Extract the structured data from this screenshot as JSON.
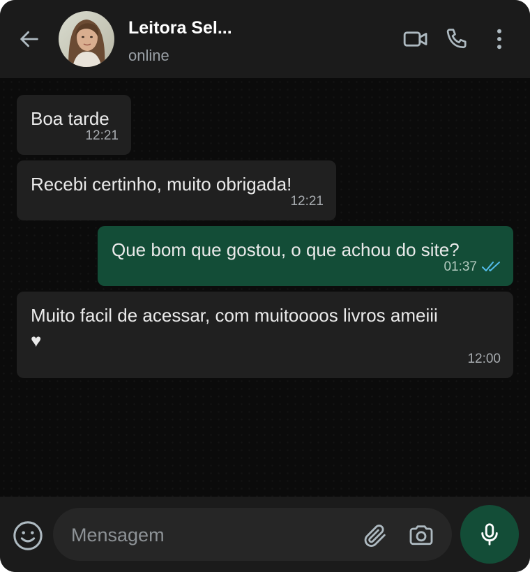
{
  "header": {
    "contact_name": "Leitora Sel...",
    "status": "online",
    "icons": {
      "back": "arrow-left-icon",
      "video": "video-camera-icon",
      "call": "phone-icon",
      "menu": "more-vertical-icon"
    }
  },
  "messages": [
    {
      "direction": "incoming",
      "text": "Boa tarde",
      "time": "12:21"
    },
    {
      "direction": "incoming",
      "text": "Recebi certinho, muito obrigada!",
      "time": "12:21"
    },
    {
      "direction": "outgoing",
      "text": "Que bom que gostou, o que achou do site?",
      "time": "01:37",
      "status": "read",
      "status_icon": "double-check-icon"
    },
    {
      "direction": "incoming",
      "text": "Muito facil de acessar, com muitoooos livros ameiii\n♥",
      "time": "12:00"
    }
  ],
  "composer": {
    "placeholder": "Mensagem",
    "value": "",
    "icons": {
      "emoji": "emoji-icon",
      "attach": "paperclip-icon",
      "camera": "camera-icon",
      "mic": "microphone-icon"
    }
  },
  "colors": {
    "background": "#0b0b0b",
    "header": "#1b1b1b",
    "incoming_bubble": "#202020",
    "outgoing_bubble": "#134d37",
    "read_ticks": "#53bdeb",
    "icon": "#aebac1"
  }
}
